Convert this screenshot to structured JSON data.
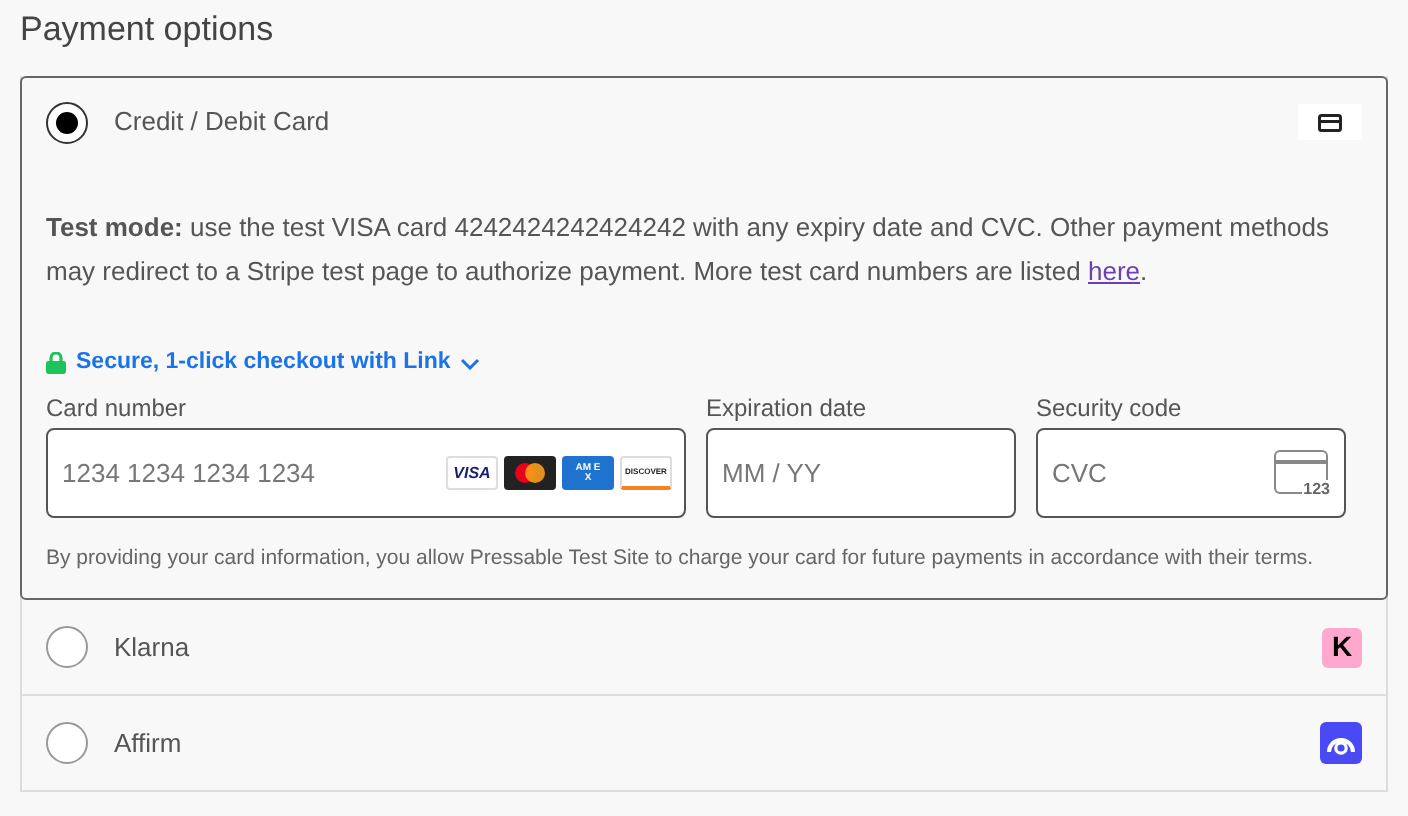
{
  "heading": "Payment options",
  "methods": [
    {
      "label": "Credit / Debit Card",
      "selected": true,
      "kind": "card"
    },
    {
      "label": "Klarna",
      "selected": false,
      "kind": "klarna",
      "logo_text": "K"
    },
    {
      "label": "Affirm",
      "selected": false,
      "kind": "affirm"
    }
  ],
  "card_form": {
    "notice": "**Test mode:** use the test VISA card 4242424242424242 with any expiry date and CVC. Other payment methods may redirect to a Stripe test page to authorize payment. More test card numbers are listed",
    "notice_link": "here",
    "notice_end": ".",
    "link_checkout": "Secure, 1-click checkout with Link",
    "fields": [
      {
        "label": "Card number",
        "placeholder": "1234 1234 1234 1234",
        "kind": "number"
      },
      {
        "label": "Expiration date",
        "placeholder": "MM / YY",
        "kind": "expiry"
      },
      {
        "label": "Security code",
        "placeholder": "CVC",
        "kind": "cvc",
        "icon_text": "123"
      }
    ],
    "brands": [
      {
        "kind": "visa",
        "text": "VISA"
      },
      {
        "kind": "mastercard"
      },
      {
        "kind": "amex",
        "text": "AM EX"
      },
      {
        "kind": "discover",
        "text": "DISCOVER"
      }
    ],
    "terms": "By providing your card information, you allow Pressable Test Site to charge your card for future payments in accordance with their terms."
  }
}
